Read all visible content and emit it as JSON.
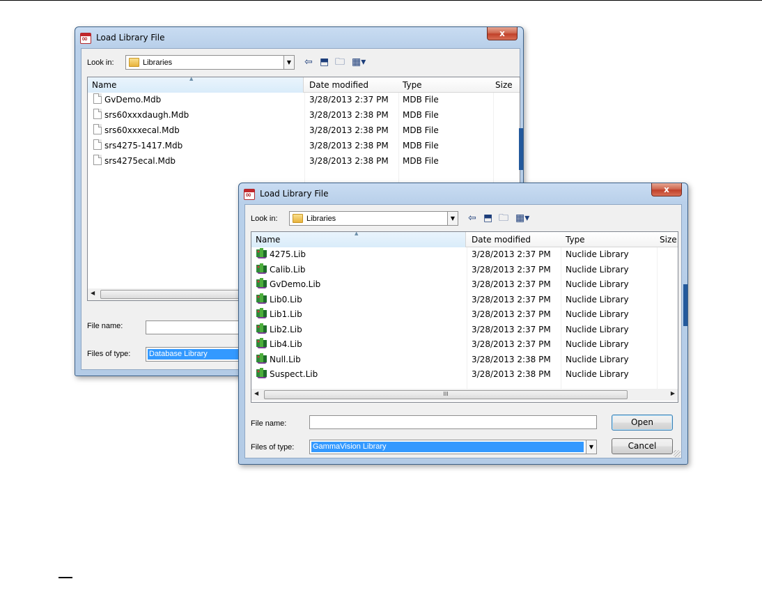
{
  "dialog_back": {
    "title": "Load Library File",
    "close_label": "x",
    "look_in_label": "Look in:",
    "look_in_value": "Libraries",
    "columns": [
      "Name",
      "Date modified",
      "Type",
      "Size"
    ],
    "files": [
      {
        "name": "GvDemo.Mdb",
        "date": "3/28/2013 2:37 PM",
        "type": "MDB File"
      },
      {
        "name": "srs60xxxdaugh.Mdb",
        "date": "3/28/2013 2:38 PM",
        "type": "MDB File"
      },
      {
        "name": "srs60xxxecal.Mdb",
        "date": "3/28/2013 2:38 PM",
        "type": "MDB File"
      },
      {
        "name": "srs4275-1417.Mdb",
        "date": "3/28/2013 2:38 PM",
        "type": "MDB File"
      },
      {
        "name": "srs4275ecal.Mdb",
        "date": "3/28/2013 2:38 PM",
        "type": "MDB File"
      }
    ],
    "file_name_label": "File name:",
    "file_name_value": "",
    "files_of_type_label": "Files of type:",
    "files_of_type_value": "Database Library"
  },
  "dialog_front": {
    "title": "Load Library File",
    "close_label": "x",
    "look_in_label": "Look in:",
    "look_in_value": "Libraries",
    "columns": [
      "Name",
      "Date modified",
      "Type",
      "Size"
    ],
    "files": [
      {
        "name": "4275.Lib",
        "date": "3/28/2013 2:37 PM",
        "type": "Nuclide Library"
      },
      {
        "name": "Calib.Lib",
        "date": "3/28/2013 2:37 PM",
        "type": "Nuclide Library"
      },
      {
        "name": "GvDemo.Lib",
        "date": "3/28/2013 2:37 PM",
        "type": "Nuclide Library"
      },
      {
        "name": "Lib0.Lib",
        "date": "3/28/2013 2:37 PM",
        "type": "Nuclide Library"
      },
      {
        "name": "Lib1.Lib",
        "date": "3/28/2013 2:37 PM",
        "type": "Nuclide Library"
      },
      {
        "name": "Lib2.Lib",
        "date": "3/28/2013 2:37 PM",
        "type": "Nuclide Library"
      },
      {
        "name": "Lib4.Lib",
        "date": "3/28/2013 2:37 PM",
        "type": "Nuclide Library"
      },
      {
        "name": "Null.Lib",
        "date": "3/28/2013 2:38 PM",
        "type": "Nuclide Library"
      },
      {
        "name": "Suspect.Lib",
        "date": "3/28/2013 2:38 PM",
        "type": "Nuclide Library"
      }
    ],
    "scroll_thumb_label": "III",
    "file_name_label": "File name:",
    "file_name_value": "",
    "files_of_type_label": "Files of type:",
    "files_of_type_value": "GammaVision Library",
    "open_label": "Open",
    "cancel_label": "Cancel"
  },
  "icons": {
    "back": "back-arrow-icon",
    "up": "up-folder-icon",
    "new_folder": "new-folder-icon",
    "view_menu": "view-menu-icon",
    "colors": {
      "selection": "#3399ff",
      "close": "#c1412a",
      "frame": "#b3cbe6"
    }
  }
}
